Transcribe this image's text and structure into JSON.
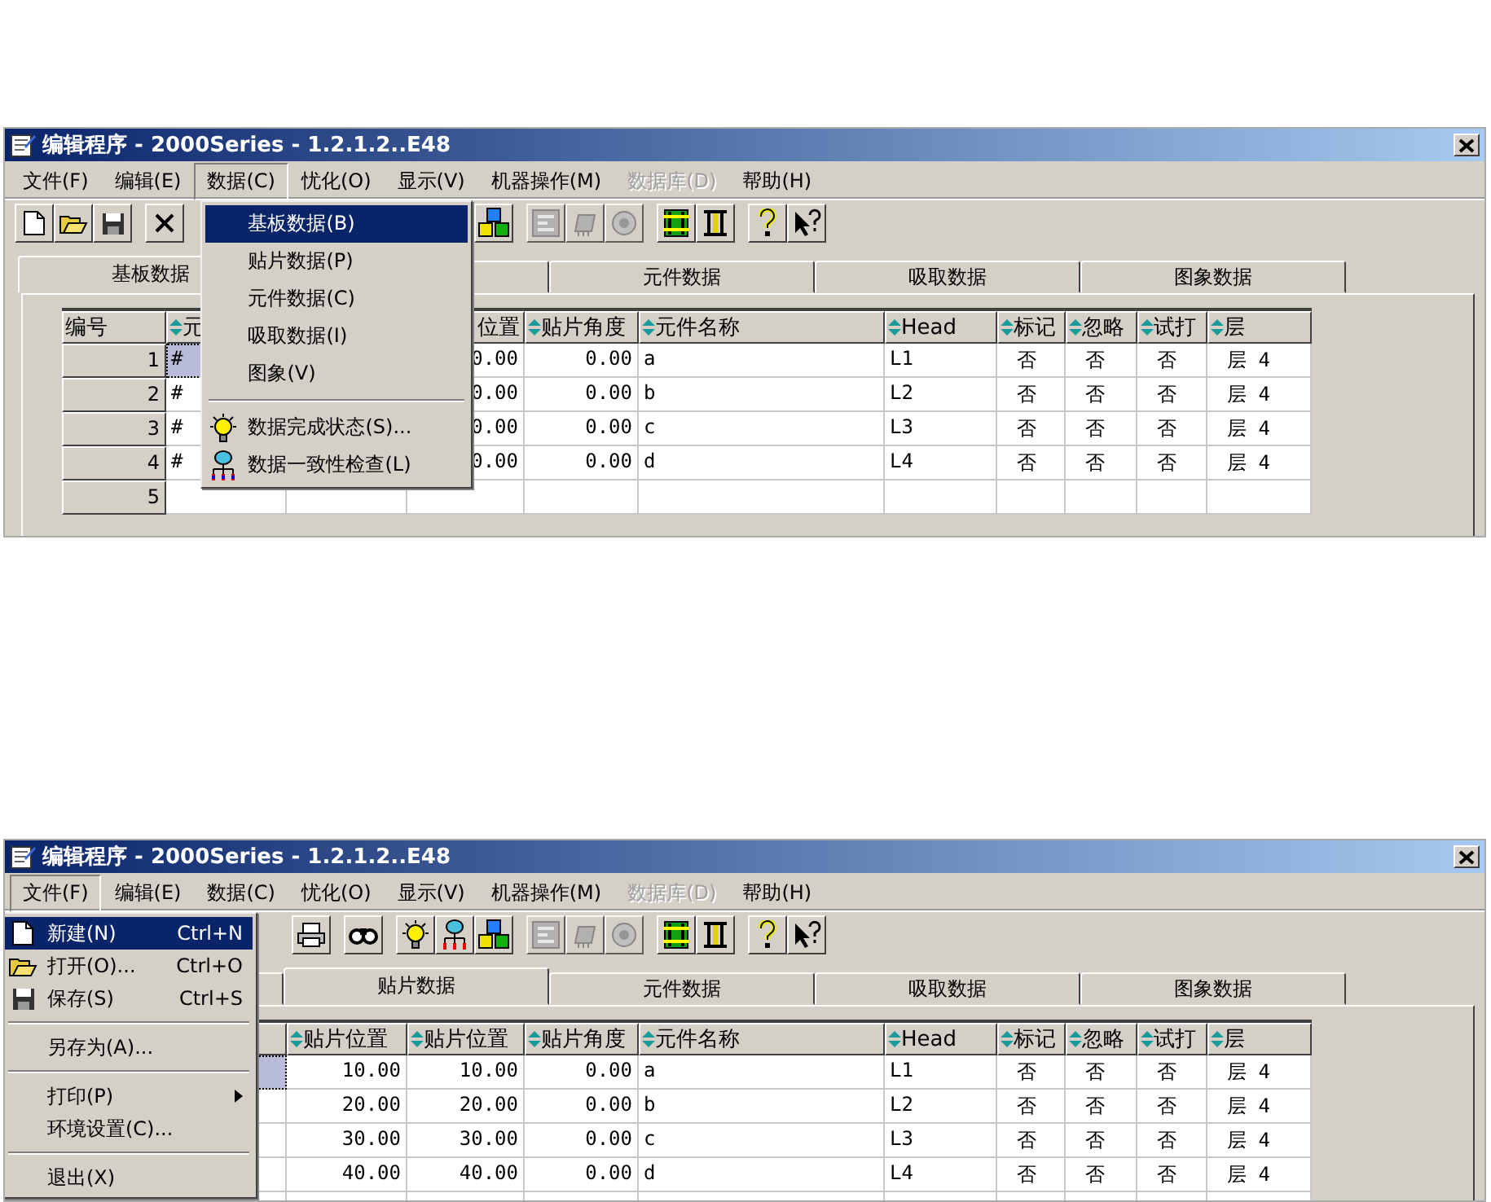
{
  "screens": [
    {
      "window": {
        "title": "编辑程序  - 2000Series - 1.2.1.2..E48"
      },
      "menu": [
        {
          "label": "文件(F)",
          "selected": false,
          "disabled": false
        },
        {
          "label": "编辑(E)",
          "selected": false,
          "disabled": false
        },
        {
          "label": "数据(C)",
          "selected": true,
          "disabled": false
        },
        {
          "label": "忧化(O)",
          "selected": false,
          "disabled": false
        },
        {
          "label": "显示(V)",
          "selected": false,
          "disabled": false
        },
        {
          "label": "机器操作(M)",
          "selected": false,
          "disabled": false
        },
        {
          "label": "数据库(D)",
          "selected": false,
          "disabled": true
        },
        {
          "label": "帮助(H)",
          "selected": false,
          "disabled": false
        }
      ],
      "open_menu": [
        {
          "kind": "item",
          "label": "基板数据(B)",
          "selected": true,
          "submenu": false
        },
        {
          "kind": "item",
          "label": "贴片数据(P)",
          "selected": false,
          "submenu": false
        },
        {
          "kind": "item",
          "label": "元件数据(C)",
          "selected": false,
          "submenu": false
        },
        {
          "kind": "item",
          "label": "吸取数据(I)",
          "selected": false,
          "submenu": false
        },
        {
          "kind": "item",
          "label": "图象(V)",
          "selected": false,
          "submenu": false
        },
        {
          "kind": "separator"
        },
        {
          "kind": "item",
          "label": "数据完成状态(S)...",
          "selected": false,
          "submenu": false
        },
        {
          "kind": "item",
          "label": "数据一致性检查(L)",
          "selected": false,
          "submenu": false
        }
      ],
      "tabs": [
        {
          "label": "基板数据",
          "selected": true
        },
        {
          "selected": false
        },
        {
          "label": "元件数据",
          "selected": false
        },
        {
          "label": "吸取数据",
          "selected": false
        },
        {
          "label": "图象数据",
          "selected": false
        }
      ],
      "table": {
        "columns": [
          {
            "label": "编号",
            "sortable": false
          },
          {
            "label": "元",
            "sortable": true
          },
          {},
          {
            "label": "位置",
            "sortable": false
          },
          {
            "label": "贴片角度",
            "sortable": true
          },
          {
            "label": "元件名称",
            "sortable": true
          },
          {
            "label": "Head",
            "sortable": true
          },
          {
            "label": "标记",
            "sortable": true
          },
          {
            "label": "忽略",
            "sortable": true
          },
          {
            "label": "试打",
            "sortable": true
          },
          {
            "label": "层",
            "sortable": true
          }
        ],
        "rows": [
          {
            "selected": true,
            "cells": [
              "1",
              "#",
              null,
              "0.00",
              "0.00",
              "a",
              "L1",
              "否",
              "否",
              "否",
              "层 4"
            ]
          },
          {
            "selected": false,
            "cells": [
              "2",
              "#",
              null,
              "0.00",
              "0.00",
              "b",
              "L2",
              "否",
              "否",
              "否",
              "层 4"
            ]
          },
          {
            "selected": false,
            "cells": [
              "3",
              "#",
              null,
              "0.00",
              "0.00",
              "c",
              "L3",
              "否",
              "否",
              "否",
              "层 4"
            ]
          },
          {
            "selected": false,
            "cells": [
              "4",
              "#",
              null,
              "0.00",
              "0.00",
              "d",
              "L4",
              "否",
              "否",
              "否",
              "层 4"
            ]
          },
          {
            "selected": false,
            "cells": [
              "5"
            ]
          }
        ]
      }
    },
    {
      "window": {
        "title": "编辑程序  - 2000Series - 1.2.1.2..E48"
      },
      "menu": [
        {
          "label": "文件(F)",
          "selected": true,
          "disabled": false
        },
        {
          "label": "编辑(E)",
          "selected": false,
          "disabled": false
        },
        {
          "label": "数据(C)",
          "selected": false,
          "disabled": false
        },
        {
          "label": "忧化(O)",
          "selected": false,
          "disabled": false
        },
        {
          "label": "显示(V)",
          "selected": false,
          "disabled": false
        },
        {
          "label": "机器操作(M)",
          "selected": false,
          "disabled": false
        },
        {
          "label": "数据库(D)",
          "selected": false,
          "disabled": true
        },
        {
          "label": "帮助(H)",
          "selected": false,
          "disabled": false
        }
      ],
      "open_menu": [
        {
          "kind": "item",
          "label": "新建(N)",
          "shortcut": "Ctrl+N",
          "selected": true,
          "submenu": false
        },
        {
          "kind": "item",
          "label": "打开(O)...",
          "shortcut": "Ctrl+O",
          "selected": false,
          "submenu": false
        },
        {
          "kind": "item",
          "label": "保存(S)",
          "shortcut": "Ctrl+S",
          "selected": false,
          "submenu": false
        },
        {
          "kind": "separator"
        },
        {
          "kind": "item",
          "label": "另存为(A)...",
          "selected": false,
          "submenu": false
        },
        {
          "kind": "separator"
        },
        {
          "kind": "item",
          "label": "打印(P)",
          "selected": false,
          "submenu": true
        },
        {
          "kind": "item",
          "label": "环境设置(C)...",
          "selected": false,
          "submenu": false
        },
        {
          "kind": "separator"
        },
        {
          "kind": "item",
          "label": "退出(X)",
          "selected": false,
          "submenu": false
        }
      ],
      "tabs": [
        {
          "selected": false
        },
        {
          "label": "贴片数据",
          "selected": true
        },
        {
          "label": "元件数据",
          "selected": false
        },
        {
          "label": "吸取数据",
          "selected": false
        },
        {
          "label": "图象数据",
          "selected": false
        }
      ],
      "table": {
        "columns": [
          {},
          {},
          {
            "label": "贴片位置",
            "sortable": true
          },
          {
            "label": "贴片位置",
            "sortable": true
          },
          {
            "label": "贴片角度",
            "sortable": true
          },
          {
            "label": "元件名称",
            "sortable": true
          },
          {
            "label": "Head",
            "sortable": true
          },
          {
            "label": "标记",
            "sortable": true
          },
          {
            "label": "忽略",
            "sortable": true
          },
          {
            "label": "试打",
            "sortable": true
          },
          {
            "label": "层",
            "sortable": true
          }
        ],
        "rows": [
          {
            "selected": true,
            "cells": [
              null,
              null,
              "10.00",
              "10.00",
              "0.00",
              "a",
              "L1",
              "否",
              "否",
              "否",
              "层 4"
            ]
          },
          {
            "selected": false,
            "cells": [
              null,
              null,
              "20.00",
              "20.00",
              "0.00",
              "b",
              "L2",
              "否",
              "否",
              "否",
              "层 4"
            ]
          },
          {
            "selected": false,
            "cells": [
              null,
              null,
              "30.00",
              "30.00",
              "0.00",
              "c",
              "L3",
              "否",
              "否",
              "否",
              "层 4"
            ]
          },
          {
            "selected": false,
            "cells": [
              null,
              null,
              "40.00",
              "40.00",
              "0.00",
              "d",
              "L4",
              "否",
              "否",
              "否",
              "层 4"
            ]
          },
          {
            "selected": false,
            "cells": []
          }
        ]
      }
    }
  ]
}
